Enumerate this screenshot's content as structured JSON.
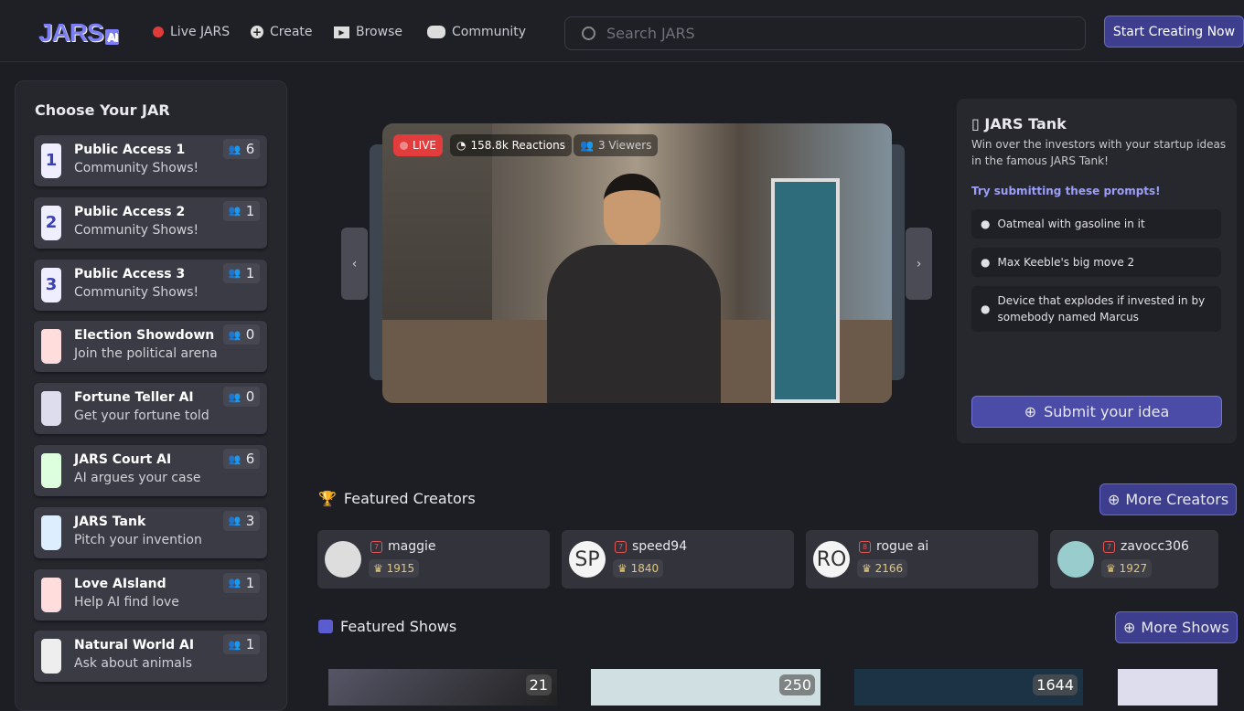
{
  "header": {
    "logo": "JARS",
    "logo_suffix": "AI",
    "nav": [
      {
        "label": "Live JARS",
        "icon": "live-dot-icon"
      },
      {
        "label": "Create",
        "icon": "plus-circle-icon"
      },
      {
        "label": "Browse",
        "icon": "play-screen-icon"
      },
      {
        "label": "Community",
        "icon": "discord-icon"
      }
    ],
    "search_placeholder": "Search JARS",
    "start_label": "Start Creating Now"
  },
  "sidebar": {
    "title": "Choose Your JAR",
    "items": [
      {
        "title": "Public Access 1",
        "subtitle": "Community Shows!",
        "count": "6",
        "glyph": "1"
      },
      {
        "title": "Public Access 2",
        "subtitle": "Community Shows!",
        "count": "1",
        "glyph": "2"
      },
      {
        "title": "Public Access 3",
        "subtitle": "Community Shows!",
        "count": "1",
        "glyph": "3"
      },
      {
        "title": "Election Showdown",
        "subtitle": "Join the political arena",
        "count": "0",
        "glyph": ""
      },
      {
        "title": "Fortune Teller AI",
        "subtitle": "Get your fortune told",
        "count": "0",
        "glyph": ""
      },
      {
        "title": "JARS Court AI",
        "subtitle": "AI argues your case",
        "count": "6",
        "glyph": ""
      },
      {
        "title": "JARS Tank",
        "subtitle": "Pitch your invention",
        "count": "3",
        "glyph": ""
      },
      {
        "title": "Love AIsland",
        "subtitle": "Help AI find love",
        "count": "1",
        "glyph": ""
      },
      {
        "title": "Natural World AI",
        "subtitle": "Ask about animals",
        "count": "1",
        "glyph": ""
      }
    ]
  },
  "player": {
    "live": "LIVE",
    "reactions": "158.8k Reactions",
    "viewers": "3 Viewers"
  },
  "panel": {
    "title": "JARS Tank",
    "description": "Win over the investors with your startup ideas in the famous JARS Tank!",
    "try_label": "Try submitting these prompts!",
    "prompts": [
      "Oatmeal with gasoline in it",
      "Max Keeble's big move 2",
      "Device that explodes if invested in by somebody named Marcus"
    ],
    "submit": "Submit your idea"
  },
  "creators": {
    "title": "Featured Creators",
    "more": "More Creators",
    "items": [
      {
        "name": "maggie",
        "score": "1915",
        "avatar": "",
        "level": "7"
      },
      {
        "name": "speed94",
        "score": "1840",
        "avatar": "SP",
        "level": "7"
      },
      {
        "name": "rogue ai",
        "score": "2166",
        "avatar": "RO",
        "level": "8"
      },
      {
        "name": "zavocc306",
        "score": "1927",
        "avatar": "",
        "level": "7"
      }
    ]
  },
  "shows": {
    "title": "Featured Shows",
    "more": "More Shows",
    "items": [
      {
        "count": "21"
      },
      {
        "count": "250"
      },
      {
        "count": "1644"
      },
      {
        "count": ""
      }
    ]
  }
}
